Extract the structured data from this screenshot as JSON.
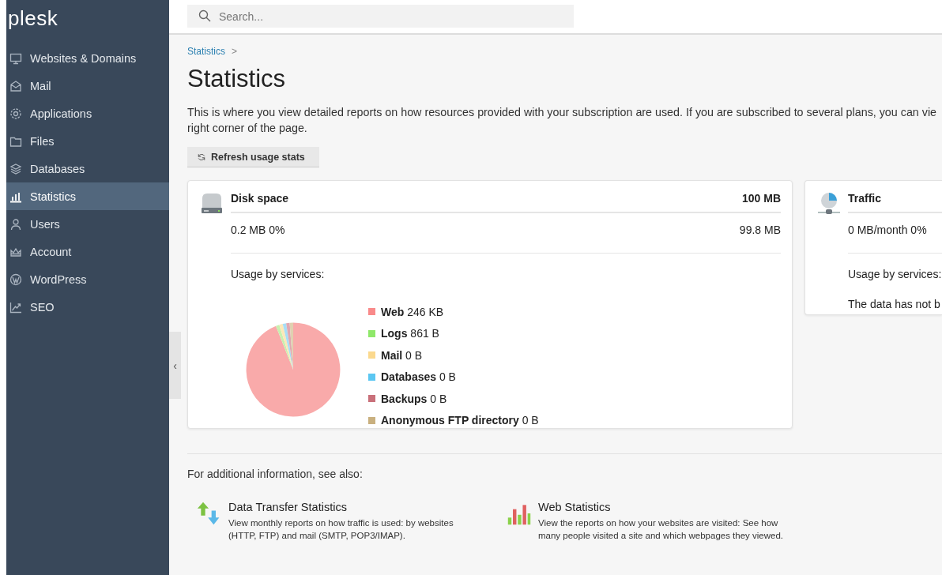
{
  "sidebar": {
    "logo": "plesk",
    "items": [
      {
        "label": "Websites & Domains",
        "selected": false
      },
      {
        "label": "Mail",
        "selected": false
      },
      {
        "label": "Applications",
        "selected": false
      },
      {
        "label": "Files",
        "selected": false
      },
      {
        "label": "Databases",
        "selected": false
      },
      {
        "label": "Statistics",
        "selected": true
      },
      {
        "label": "Users",
        "selected": false
      },
      {
        "label": "Account",
        "selected": false
      },
      {
        "label": "WordPress",
        "selected": false
      },
      {
        "label": "SEO",
        "selected": false
      }
    ],
    "collapse": "‹"
  },
  "search": {
    "placeholder": "Search..."
  },
  "breadcrumb": {
    "link": "Statistics",
    "separator": ">"
  },
  "page_title": "Statistics",
  "description_lines": [
    "This is where you view detailed reports on how resources provided with your subscription are used. If you are subscribed to several plans, you can vie",
    "right corner of the page."
  ],
  "refresh_button": "Refresh usage stats",
  "disk_card": {
    "title": "Disk space",
    "total": "100 MB",
    "used": "0.2 MB 0%",
    "free": "99.8 MB",
    "usage_label": "Usage by services:",
    "services": [
      {
        "name": "Web",
        "amount": "246 KB",
        "color": "#f98a8a"
      },
      {
        "name": "Logs",
        "amount": "861 B",
        "color": "#8fe86a"
      },
      {
        "name": "Mail",
        "amount": "0 B",
        "color": "#fbd98e"
      },
      {
        "name": "Databases",
        "amount": "0 B",
        "color": "#5cc7f2"
      },
      {
        "name": "Backups",
        "amount": "0 B",
        "color": "#c9707a"
      },
      {
        "name": "Anonymous FTP directory",
        "amount": "0 B",
        "color": "#c9b07f"
      }
    ]
  },
  "traffic_card": {
    "title": "Traffic",
    "used": "0 MB/month 0%",
    "usage_label": "Usage by services:",
    "message": "The data has not b"
  },
  "see_also": {
    "heading": "For additional information, see also:",
    "links": [
      {
        "kind": "transfer",
        "title": "Data Transfer Statistics",
        "lines": [
          "View monthly reports on how traffic is used: by websites",
          "(HTTP, FTP) and mail (SMTP, POP3/IMAP)."
        ]
      },
      {
        "kind": "web",
        "title": "Web Statistics",
        "lines": [
          "View the reports on how your websites are visited: See how",
          "many people visited a site and which webpages they viewed."
        ]
      }
    ]
  }
}
